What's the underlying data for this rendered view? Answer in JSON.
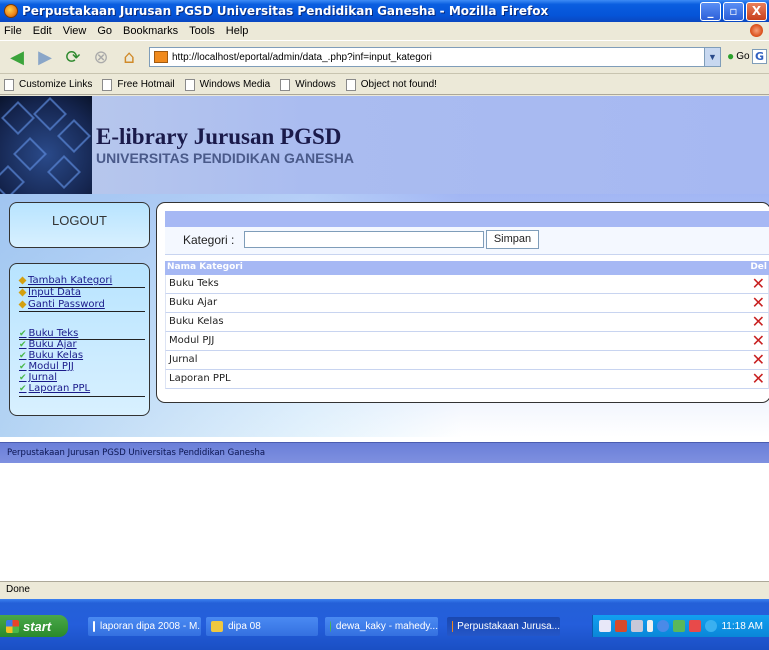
{
  "window": {
    "title": "Perpustakaan Jurusan PGSD Universitas Pendidikan Ganesha - Mozilla Firefox",
    "minimize": "_",
    "maximize": "▫",
    "close": "X"
  },
  "menubar": [
    "File",
    "Edit",
    "View",
    "Go",
    "Bookmarks",
    "Tools",
    "Help"
  ],
  "navbar": {
    "url": "http://localhost/eportal/admin/data_.php?inf=input_kategori",
    "go_label": "Go",
    "search_engine": "G"
  },
  "bookmarks": [
    "Customize Links",
    "Free Hotmail",
    "Windows Media",
    "Windows",
    "Object not found!"
  ],
  "header": {
    "title": "E-library Jurusan PGSD",
    "subtitle": "UNIVERSITAS PENDIDIKAN GANESHA"
  },
  "sidebar": {
    "logout": "LOGOUT",
    "admin_links": [
      "Tambah Kategori",
      "Input Data",
      "Ganti Password"
    ],
    "category_links": [
      "Buku Teks",
      "Buku Ajar",
      "Buku Kelas",
      "Modul PJJ",
      "Jurnal",
      "Laporan PPL"
    ]
  },
  "form": {
    "label": "Kategori :",
    "input_value": "",
    "submit": "Simpan"
  },
  "table": {
    "headers": {
      "name": "Nama Kategori",
      "del": "Del"
    },
    "rows": [
      "Buku Teks",
      "Buku Ajar",
      "Buku Kelas",
      "Modul PJJ",
      "Jurnal",
      "Laporan PPL"
    ],
    "delete_glyph": "✕"
  },
  "footer": "Perpustakaan Jurusan PGSD Universitas Pendidikan Ganesha",
  "status": "Done",
  "taskbar": {
    "start": "start",
    "tasks": [
      "laporan dipa 2008 - M...",
      "dipa 08",
      "dewa_kaky - mahedy...",
      "Perpustakaan Jurusa..."
    ],
    "clock": "11:18 AM"
  },
  "colors": {
    "header_bg": "#a6b8f2",
    "panel_bg": "#b8e4ff",
    "table_head": "#a6b8f4",
    "delete": "#c82020",
    "footer_bg": "#7082da"
  }
}
